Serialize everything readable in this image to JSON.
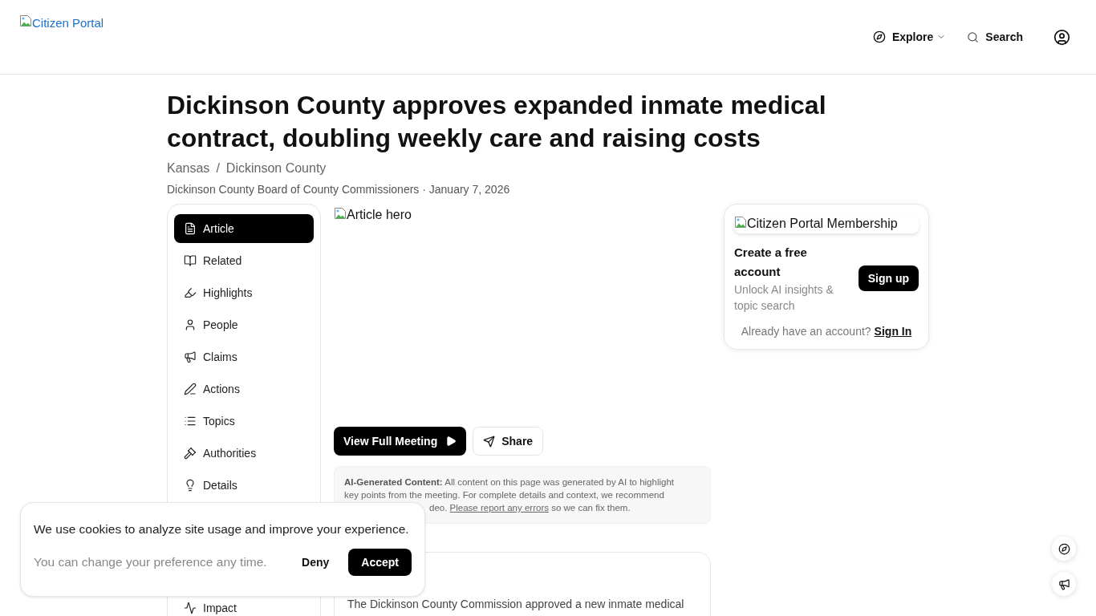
{
  "header": {
    "logo_alt": "Citizen Portal",
    "nav": [
      {
        "kind": "menu",
        "label": "Explore"
      },
      {
        "kind": "search",
        "label": "Search"
      }
    ]
  },
  "article": {
    "title": "Dickinson County approves expanded inmate medical contract, doubling weekly care and raising costs",
    "breadcrumb": {
      "separator": "/",
      "items": [
        "Kansas",
        "Dickinson County"
      ]
    },
    "byline": "Dickinson County Board of County Commissioners · January 7, 2026"
  },
  "sidebar": {
    "items": [
      {
        "kind": "article",
        "label": "Article",
        "selected": true
      },
      {
        "kind": "related",
        "label": "Related",
        "selected": false
      },
      {
        "kind": "highlights",
        "label": "Highlights",
        "selected": false
      },
      {
        "kind": "people",
        "label": "People",
        "selected": false
      },
      {
        "kind": "claims",
        "label": "Claims",
        "selected": false
      },
      {
        "kind": "actions",
        "label": "Actions",
        "selected": false
      },
      {
        "kind": "topics",
        "label": "Topics",
        "selected": false
      },
      {
        "kind": "authorities",
        "label": "Authorities",
        "selected": false
      },
      {
        "kind": "details",
        "label": "Details",
        "selected": false
      }
    ],
    "items_below_banner": [
      {
        "kind": "impact",
        "label": "Impact",
        "selected": false
      }
    ]
  },
  "hero": {
    "alt": "Article hero"
  },
  "actions": [
    {
      "kind": "watch",
      "label": "View Full Meeting"
    },
    {
      "kind": "share",
      "label": "Share"
    }
  ],
  "disclaimer": {
    "lines": [
      "**AI-Generated Content:** All content on this page was generated by AI to highlight",
      "key points from the meeting. For complete details and context, we recommend"
    ],
    "tail_before_link": "deo.",
    "link": "Please report any errors",
    "tail_after_link": "so we can fix them."
  },
  "summary": {
    "text": "The Dickinson County Commission approved a new inmate medical"
  },
  "membership": {
    "image_alt": "Citizen Portal Membership",
    "title": "Create a free account",
    "subtitle": "Unlock AI insights & topic search",
    "button": "Sign up",
    "signin_prompt": "Already have an account?",
    "signin_link": "Sign In"
  },
  "cookie_banner": {
    "message": "We use cookies to analyze site usage and improve your experience.",
    "note": "You can change your preference any time.",
    "buttons": [
      {
        "kind": "deny",
        "label": "Deny"
      },
      {
        "kind": "accept",
        "label": "Accept"
      }
    ]
  }
}
